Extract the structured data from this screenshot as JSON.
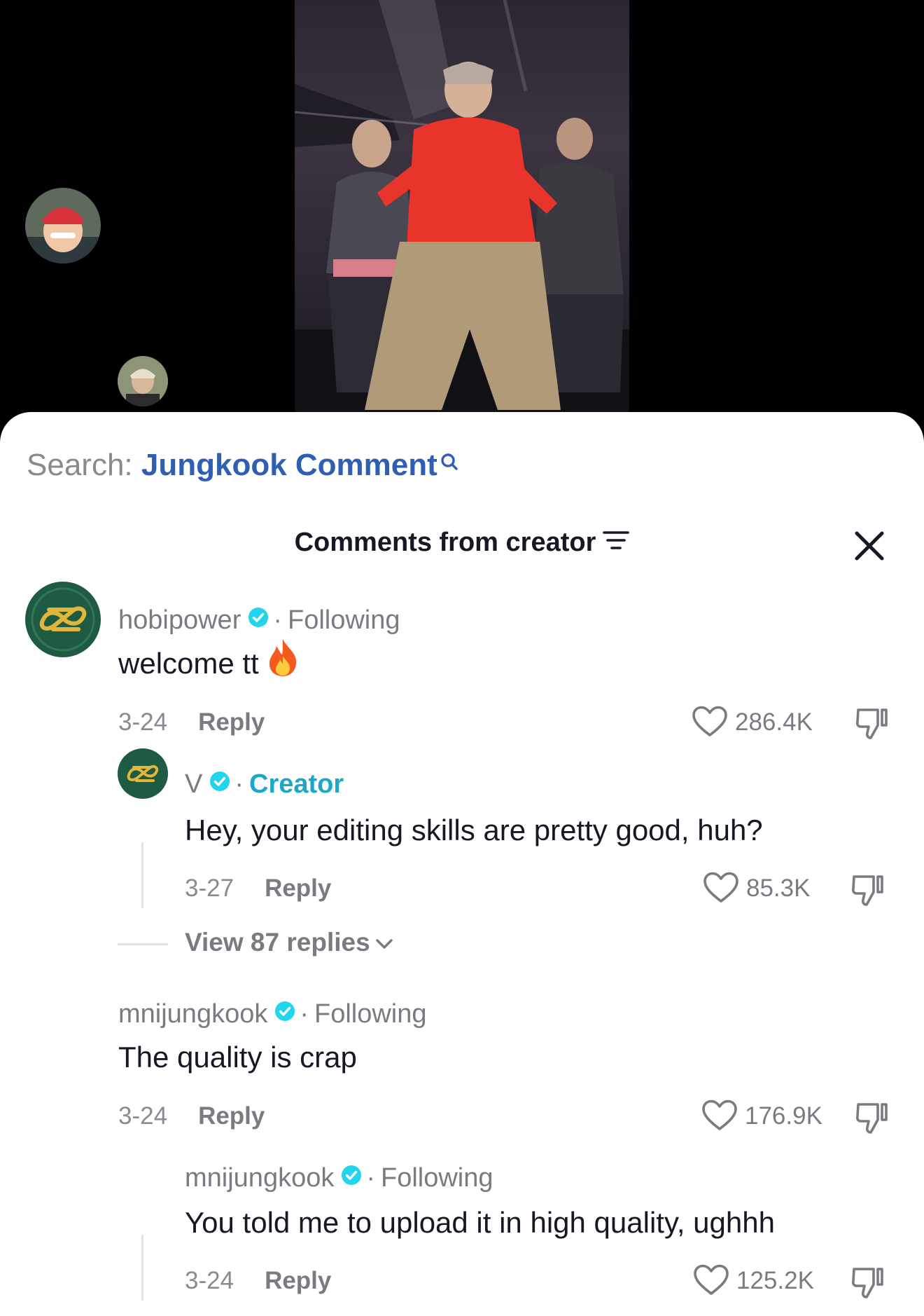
{
  "search": {
    "prefix": "Search:",
    "query": "Jungkook Comment",
    "icon": "search-icon"
  },
  "header": {
    "title": "Comments from creator",
    "filter_icon": "filter-icon",
    "close_icon": "close-icon"
  },
  "comments": [
    {
      "username": "hobipower",
      "verified": true,
      "relation": "Following",
      "text": "welcome tt",
      "emoji": "🔥",
      "date": "3-24",
      "reply_label": "Reply",
      "likes": "286.4K",
      "replies": [
        {
          "username": "V",
          "verified": true,
          "relation": "Creator",
          "text": "Hey, your editing skills are pretty good, huh?",
          "date": "3-27",
          "reply_label": "Reply",
          "likes": "85.3K"
        }
      ],
      "view_replies": "View 87 replies"
    },
    {
      "username": "mnijungkook",
      "verified": true,
      "relation": "Following",
      "text": "The quality is crap",
      "date": "3-24",
      "reply_label": "Reply",
      "likes": "176.9K",
      "replies": [
        {
          "username": "mnijungkook",
          "verified": true,
          "relation": "Following",
          "text": "You told me to upload it in high quality, ughhh",
          "date": "3-24",
          "reply_label": "Reply",
          "likes": "125.2K"
        }
      ]
    }
  ],
  "colors": {
    "search_query": "#2f5fb4",
    "creator_label": "#1aa7c9",
    "verified_badge": "#20d5ec",
    "text_primary": "#161823",
    "text_secondary": "#7a7b80"
  }
}
